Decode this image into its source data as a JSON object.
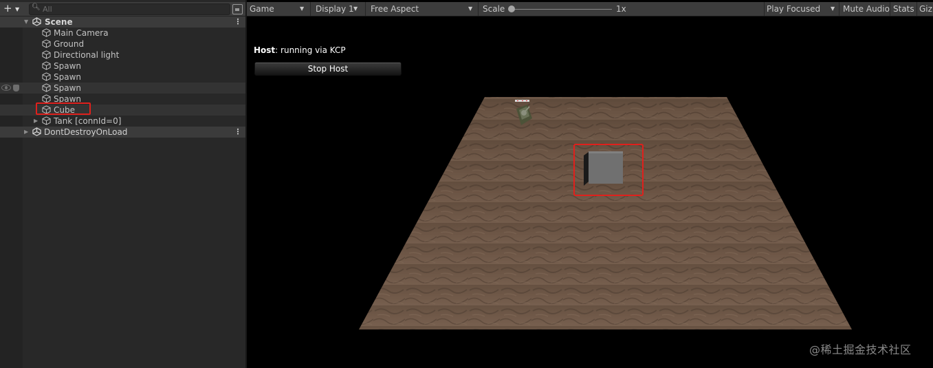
{
  "hierarchy": {
    "toolbar": {
      "add_icon": "plus-icon",
      "search_placeholder": "All"
    },
    "scene": {
      "name": "Scene",
      "icon": "unity-logo-icon"
    },
    "items": [
      {
        "label": "Main Camera",
        "icon": "cube-icon"
      },
      {
        "label": "Ground",
        "icon": "cube-icon"
      },
      {
        "label": "Directional light",
        "icon": "cube-icon"
      },
      {
        "label": "Spawn",
        "icon": "cube-icon"
      },
      {
        "label": "Spawn",
        "icon": "cube-icon"
      },
      {
        "label": "Spawn",
        "icon": "cube-icon"
      },
      {
        "label": "Spawn",
        "icon": "cube-icon"
      },
      {
        "label": "Cube",
        "icon": "cube-icon"
      },
      {
        "label": "Tank [connId=0]",
        "icon": "cube-icon"
      }
    ],
    "dont_destroy": {
      "name": "DontDestroyOnLoad",
      "icon": "unity-logo-icon"
    }
  },
  "game_toolbar": {
    "view": "Game",
    "display": "Display 1",
    "aspect": "Free Aspect",
    "scale_label": "Scale",
    "scale_value": "1x",
    "play_mode": "Play Focused",
    "mute": "Mute Audio",
    "stats": "Stats",
    "gizmos": "Giz"
  },
  "game": {
    "host_label": "Host",
    "host_status": ": running via KCP",
    "stop_button": "Stop Host"
  },
  "watermark": "@稀土掘金技术社区",
  "colors": {
    "highlight": "#e0201c",
    "ground": "#6b5443"
  }
}
